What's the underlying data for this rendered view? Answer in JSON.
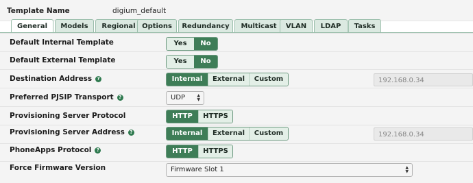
{
  "header": {
    "label": "Template Name",
    "value": "digium_default"
  },
  "tabs": [
    {
      "label": "General"
    },
    {
      "label": "Models"
    },
    {
      "label": "Regional"
    },
    {
      "label": "Options"
    },
    {
      "label": "Redundancy"
    },
    {
      "label": "Multicast"
    },
    {
      "label": "VLAN"
    },
    {
      "label": "LDAP"
    },
    {
      "label": "Tasks"
    }
  ],
  "rows": {
    "internal_template": {
      "label": "Default Internal Template",
      "opts": [
        "Yes",
        "No"
      ],
      "selected": "No"
    },
    "external_template": {
      "label": "Default External Template",
      "opts": [
        "Yes",
        "No"
      ],
      "selected": "No"
    },
    "destination": {
      "label": "Destination Address",
      "opts": [
        "Internal",
        "External",
        "Custom"
      ],
      "selected": "Internal",
      "value": "192.168.0.34"
    },
    "transport": {
      "label": "Preferred PJSIP Transport",
      "value": "UDP"
    },
    "prov_protocol": {
      "label": "Provisioning Server Protocol",
      "opts": [
        "HTTP",
        "HTTPS"
      ],
      "selected": "HTTP"
    },
    "prov_address": {
      "label": "Provisioning Server Address",
      "opts": [
        "Internal",
        "External",
        "Custom"
      ],
      "selected": "Internal",
      "value": "192.168.0.34"
    },
    "phoneapps": {
      "label": "PhoneApps Protocol",
      "opts": [
        "HTTP",
        "HTTPS"
      ],
      "selected": "HTTP"
    },
    "firmware": {
      "label": "Force Firmware Version",
      "value": "Firmware Slot 1"
    }
  },
  "colors": {
    "accent": "#3e7d57",
    "tab_bg": "#dbe9e1",
    "row_bg": "#f4f4f4"
  }
}
